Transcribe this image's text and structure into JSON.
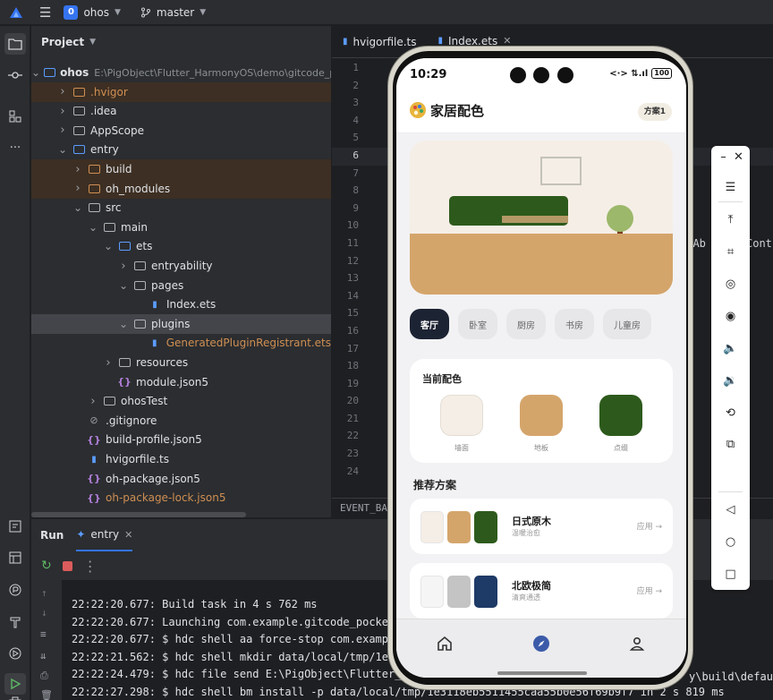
{
  "topbar": {
    "project_badge": "0",
    "project_name": "ohos",
    "branch": "master"
  },
  "project_panel": {
    "title": "Project",
    "tree": [
      {
        "label": "ohos",
        "path": "E:\\PigObject\\Flutter_HarmonyOS\\demo\\gitcode_p",
        "depth": 0,
        "expanded": true,
        "kind": "folder-blue",
        "bold": true
      },
      {
        "label": ".hvigor",
        "depth": 1,
        "expanded": false,
        "kind": "folder-orange",
        "color": "orange",
        "highlight": true
      },
      {
        "label": ".idea",
        "depth": 1,
        "expanded": false,
        "kind": "folder"
      },
      {
        "label": "AppScope",
        "depth": 1,
        "expanded": false,
        "kind": "folder"
      },
      {
        "label": "entry",
        "depth": 1,
        "expanded": true,
        "kind": "folder-blue"
      },
      {
        "label": "build",
        "depth": 2,
        "expanded": false,
        "kind": "folder-orange",
        "highlight": true
      },
      {
        "label": "oh_modules",
        "depth": 2,
        "expanded": false,
        "kind": "folder-orange",
        "highlight": true
      },
      {
        "label": "src",
        "depth": 2,
        "expanded": true,
        "kind": "folder"
      },
      {
        "label": "main",
        "depth": 3,
        "expanded": true,
        "kind": "folder"
      },
      {
        "label": "ets",
        "depth": 4,
        "expanded": true,
        "kind": "folder-blue"
      },
      {
        "label": "entryability",
        "depth": 5,
        "expanded": false,
        "kind": "folder"
      },
      {
        "label": "pages",
        "depth": 5,
        "expanded": true,
        "kind": "folder"
      },
      {
        "label": "Index.ets",
        "depth": 6,
        "kind": "ets"
      },
      {
        "label": "plugins",
        "depth": 5,
        "expanded": true,
        "kind": "folder",
        "selected": true
      },
      {
        "label": "GeneratedPluginRegistrant.ets",
        "depth": 6,
        "kind": "ets",
        "color": "orange"
      },
      {
        "label": "resources",
        "depth": 4,
        "expanded": false,
        "kind": "folder"
      },
      {
        "label": "module.json5",
        "depth": 4,
        "kind": "json"
      },
      {
        "label": "ohosTest",
        "depth": 3,
        "expanded": false,
        "kind": "folder"
      },
      {
        "label": ".gitignore",
        "depth": 2,
        "kind": "ignore"
      },
      {
        "label": "build-profile.json5",
        "depth": 2,
        "kind": "json"
      },
      {
        "label": "hvigorfile.ts",
        "depth": 2,
        "kind": "ts"
      },
      {
        "label": "oh-package.json5",
        "depth": 2,
        "kind": "json"
      },
      {
        "label": "oh-package-lock.json5",
        "depth": 2,
        "kind": "json",
        "color": "orange"
      },
      {
        "label": "hvigor",
        "depth": 1,
        "expanded": false,
        "kind": "folder",
        "color": "gray"
      }
    ]
  },
  "editor": {
    "tabs": [
      {
        "label": "hvigorfile.ts",
        "active": false
      },
      {
        "label": "Index.ets",
        "active": true
      }
    ],
    "line_numbers": [
      "1",
      "2",
      "3",
      "4",
      "5",
      "6",
      "7",
      "8",
      "9",
      "10",
      "11",
      "12",
      "13",
      "14",
      "15",
      "16",
      "17",
      "18",
      "19",
      "20",
      "21",
      "22",
      "23",
      "24"
    ],
    "fragments": [
      {
        "text": "i",
        "line": 2
      },
      {
        "text": "i",
        "line": 3
      },
      {
        "text": "l",
        "line": 5
      },
      {
        "text": "c",
        "line": 6
      },
      {
        "text": "@",
        "line": 8
      },
      {
        "text": "@",
        "line": 9
      },
      {
        "text": "s",
        "line": 10
      },
      {
        "text": "}",
        "line": 24
      }
    ],
    "right_fragments": [
      "UIAb",
      "Cont"
    ],
    "status": "EVENT_BAC"
  },
  "run_panel": {
    "title": "Run",
    "config": "entry",
    "lines": [
      "22:22:20.677: Build task in 4 s 762 ms",
      "22:22:20.677: Launching com.example.gitcode_pocket",
      "22:22:20.677: $ hdc shell aa force-stop com.exampl",
      "22:22:21.562: $ hdc shell mkdir data/local/tmp/1e3",
      "22:22:24.479: $ hdc file send E:\\PigObject\\Flutter_",
      "22:22:27.298: $ hdc shell bm install -p data/local/tmp/1e3118eb5511455caa55b0e56f69b9f7 in 2 s 819 ms"
    ],
    "line_tail": "y\\build\\defaul"
  },
  "phone": {
    "status": {
      "time": "10:29",
      "icons": "<·> ⇅.ıl",
      "battery": "100"
    },
    "app": {
      "title": "家居配色",
      "scheme_button": "方案1",
      "room_tabs": [
        {
          "label": "客厅",
          "active": true
        },
        {
          "label": "卧室",
          "active": false
        },
        {
          "label": "厨房",
          "active": false
        },
        {
          "label": "书房",
          "active": false
        },
        {
          "label": "儿童房",
          "active": false
        }
      ],
      "current_palette": {
        "title": "当前配色",
        "swatches": [
          {
            "label": "墙面",
            "color": "#f5eee6"
          },
          {
            "label": "地板",
            "color": "#d4a56b"
          },
          {
            "label": "点缀",
            "color": "#2d5a1c"
          }
        ]
      },
      "recommend_title": "推荐方案",
      "schemes": [
        {
          "name": "日式原木",
          "subtitle": "温暖治愈",
          "apply": "应用 →",
          "colors": [
            "#f5eee6",
            "#d4a56b",
            "#2d5a1c"
          ]
        },
        {
          "name": "北欧极简",
          "subtitle": "清爽通透",
          "apply": "应用 →",
          "colors": [
            "#f5f5f5",
            "#c4c4c4",
            "#1e3a66"
          ]
        }
      ],
      "nav": [
        "home-icon",
        "compass-icon",
        "person-icon"
      ]
    }
  },
  "colors": {
    "accent": "#3574f0",
    "nav_active": "#3b5ba9",
    "active_tab": "#1c2333"
  }
}
